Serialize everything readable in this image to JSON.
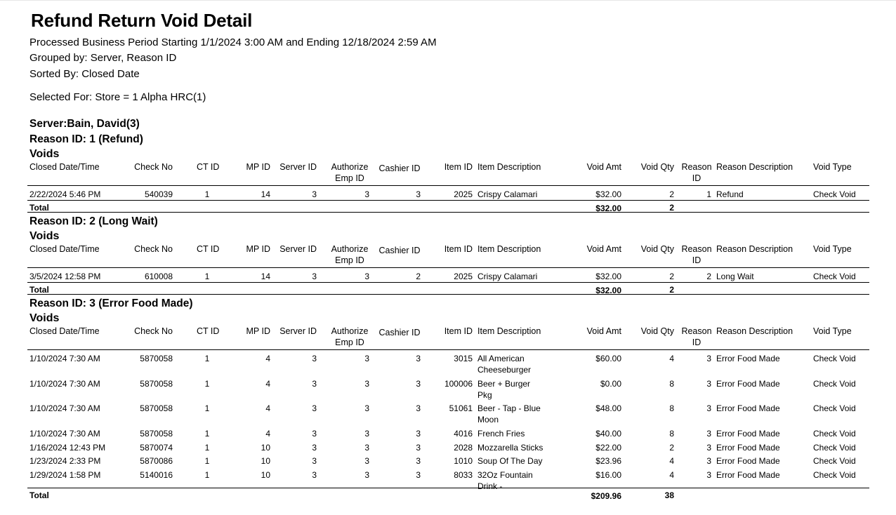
{
  "report": {
    "title": "Refund Return Void Detail",
    "period": "Processed Business Period Starting 1/1/2024 3:00 AM and Ending 12/18/2024 2:59 AM",
    "grouped_by": "Grouped by: Server, Reason ID",
    "sorted_by": "Sorted By: Closed Date",
    "selected_for": "Selected For:  Store = 1 Alpha HRC(1)"
  },
  "server": {
    "label": "Server:Bain, David(3)"
  },
  "columns": {
    "closed": "Closed Date/Time",
    "check": "Check No",
    "ct": "CT ID",
    "mp": "MP ID",
    "server": "Server ID",
    "auth1": "Authorize",
    "auth2": "Emp ID",
    "cashier": "Cashier ID",
    "item_id": "Item ID",
    "item_desc": "Item Description",
    "void_amt": "Void Amt",
    "void_qty": "Void Qty",
    "reason1": "Reason",
    "reason2": "ID",
    "reason_desc": "Reason Description",
    "void_type": "Void Type"
  },
  "voids_label": "Voids",
  "total_label": "Total",
  "groups": [
    {
      "reason": "Reason ID: 1 (Refund)",
      "rows": [
        {
          "closed": "2/22/2024 5:46 PM",
          "check": "540039",
          "ct": "1",
          "mp": "14",
          "server": "3",
          "auth": "3",
          "cashier": "3",
          "item_id": "2025",
          "item_desc": [
            "Crispy Calamari"
          ],
          "amt": "$32.00",
          "qty": "2",
          "reason_id": "1",
          "reason_desc": "Refund",
          "type": "Check Void"
        }
      ],
      "total_amt": "$32.00",
      "total_qty": "2"
    },
    {
      "reason": "Reason ID: 2 (Long Wait)",
      "rows": [
        {
          "closed": "3/5/2024 12:58 PM",
          "check": "610008",
          "ct": "1",
          "mp": "14",
          "server": "3",
          "auth": "3",
          "cashier": "2",
          "item_id": "2025",
          "item_desc": [
            "Crispy Calamari"
          ],
          "amt": "$32.00",
          "qty": "2",
          "reason_id": "2",
          "reason_desc": "Long Wait",
          "type": "Check Void"
        }
      ],
      "total_amt": "$32.00",
      "total_qty": "2"
    },
    {
      "reason": "Reason ID: 3 (Error Food Made)",
      "rows": [
        {
          "closed": "1/10/2024 7:30 AM",
          "check": "5870058",
          "ct": "1",
          "mp": "4",
          "server": "3",
          "auth": "3",
          "cashier": "3",
          "item_id": "3015",
          "item_desc": [
            "All American",
            "Cheeseburger"
          ],
          "amt": "$60.00",
          "qty": "4",
          "reason_id": "3",
          "reason_desc": "Error Food Made",
          "type": "Check Void"
        },
        {
          "closed": "1/10/2024 7:30 AM",
          "check": "5870058",
          "ct": "1",
          "mp": "4",
          "server": "3",
          "auth": "3",
          "cashier": "3",
          "item_id": "100006",
          "item_desc": [
            "Beer + Burger",
            "Pkg"
          ],
          "amt": "$0.00",
          "qty": "8",
          "reason_id": "3",
          "reason_desc": "Error Food Made",
          "type": "Check Void"
        },
        {
          "closed": "1/10/2024 7:30 AM",
          "check": "5870058",
          "ct": "1",
          "mp": "4",
          "server": "3",
          "auth": "3",
          "cashier": "3",
          "item_id": "51061",
          "item_desc": [
            "Beer - Tap - Blue",
            "Moon"
          ],
          "amt": "$48.00",
          "qty": "8",
          "reason_id": "3",
          "reason_desc": "Error Food Made",
          "type": "Check Void"
        },
        {
          "closed": "1/10/2024 7:30 AM",
          "check": "5870058",
          "ct": "1",
          "mp": "4",
          "server": "3",
          "auth": "3",
          "cashier": "3",
          "item_id": "4016",
          "item_desc": [
            "French Fries"
          ],
          "amt": "$40.00",
          "qty": "8",
          "reason_id": "3",
          "reason_desc": "Error Food Made",
          "type": "Check Void"
        },
        {
          "closed": "1/16/2024 12:43 PM",
          "check": "5870074",
          "ct": "1",
          "mp": "10",
          "server": "3",
          "auth": "3",
          "cashier": "3",
          "item_id": "2028",
          "item_desc": [
            "Mozzarella Sticks"
          ],
          "amt": "$22.00",
          "qty": "2",
          "reason_id": "3",
          "reason_desc": "Error Food Made",
          "type": "Check Void"
        },
        {
          "closed": "1/23/2024 2:33 PM",
          "check": "5870086",
          "ct": "1",
          "mp": "10",
          "server": "3",
          "auth": "3",
          "cashier": "3",
          "item_id": "1010",
          "item_desc": [
            "Soup Of The Day"
          ],
          "amt": "$23.96",
          "qty": "4",
          "reason_id": "3",
          "reason_desc": "Error Food Made",
          "type": "Check Void"
        },
        {
          "closed": "1/29/2024 1:58 PM",
          "check": "5140016",
          "ct": "1",
          "mp": "10",
          "server": "3",
          "auth": "3",
          "cashier": "3",
          "item_id": "8033",
          "item_desc": [
            "32Oz Fountain",
            "Drink -"
          ],
          "amt": "$16.00",
          "qty": "4",
          "reason_id": "3",
          "reason_desc": "Error Food Made",
          "type": "Check Void"
        }
      ],
      "total_amt": "$209.96",
      "total_qty": "38"
    }
  ]
}
